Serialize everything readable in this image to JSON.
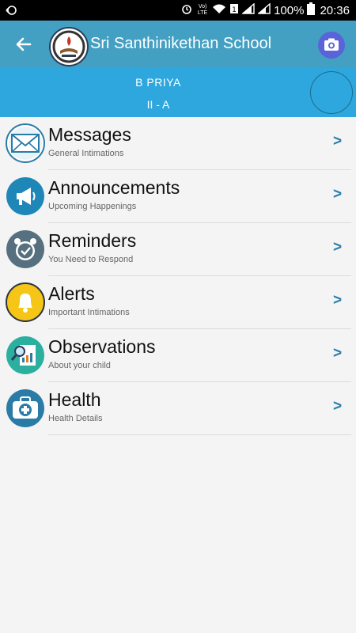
{
  "status_bar": {
    "battery": "100%",
    "time": "20:36",
    "network": "Vo) LTE"
  },
  "header": {
    "title": "Sri Santhinikethan School",
    "back_icon": "back-arrow-icon",
    "camera_icon": "camera-icon",
    "camera_color": "#5a63d8",
    "bar_color": "#43a0c3"
  },
  "student": {
    "name": "B  PRIYA",
    "class": "II - A",
    "bar_color": "#2da7dd"
  },
  "menu": [
    {
      "title": "Messages",
      "subtitle": "General Intimations",
      "icon": "envelope-icon",
      "chevron": ">"
    },
    {
      "title": "Announcements",
      "subtitle": "Upcoming Happenings",
      "icon": "megaphone-icon",
      "chevron": ">"
    },
    {
      "title": "Reminders",
      "subtitle": "You Need to Respond",
      "icon": "alarm-clock-icon",
      "chevron": ">"
    },
    {
      "title": "Alerts",
      "subtitle": "Important Intimations",
      "icon": "bell-icon",
      "chevron": ">"
    },
    {
      "title": "Observations",
      "subtitle": "About your child",
      "icon": "report-magnifier-icon",
      "chevron": ">"
    },
    {
      "title": "Health",
      "subtitle": "Health Details",
      "icon": "medical-kit-icon",
      "chevron": ">"
    }
  ]
}
